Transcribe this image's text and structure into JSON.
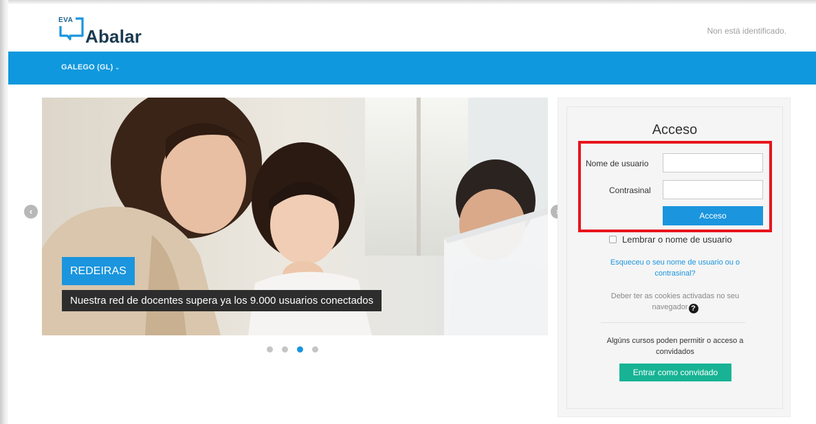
{
  "header": {
    "logo_small": "EVA",
    "logo_text": "Abalar",
    "user_status": "Non está identificado."
  },
  "navbar": {
    "language": "GALEGO (GL)",
    "language_chevron": "⌄"
  },
  "carousel": {
    "tag": "REDEIRAS",
    "caption": "Nuestra red de docentes supera ya los 9.000 usuarios conectados",
    "dots_count": 4,
    "active_dot": 3
  },
  "login": {
    "title": "Acceso",
    "username_label": "Nome de usuario",
    "username_value": "",
    "password_label": "Contrasinal",
    "password_value": "",
    "submit_label": "Acceso",
    "remember_label": "Lembrar o nome de usuario",
    "forgot_link": "Esqueceu o seu nome de usuario ou o contrasinal?",
    "cookies_note": "Deber ter as cookies activadas no seu navegador",
    "guest_note": "Algúns cursos poden permitir o acceso a convidados",
    "guest_button": "Entrar como convidado"
  },
  "colors": {
    "navbar": "#0f98dd",
    "primary_button": "#1b95dd",
    "guest_button": "#17b394",
    "highlight": "#e8141b",
    "caption_tag": "#1b95dd",
    "caption_text_bg": "#2d2d2d"
  }
}
